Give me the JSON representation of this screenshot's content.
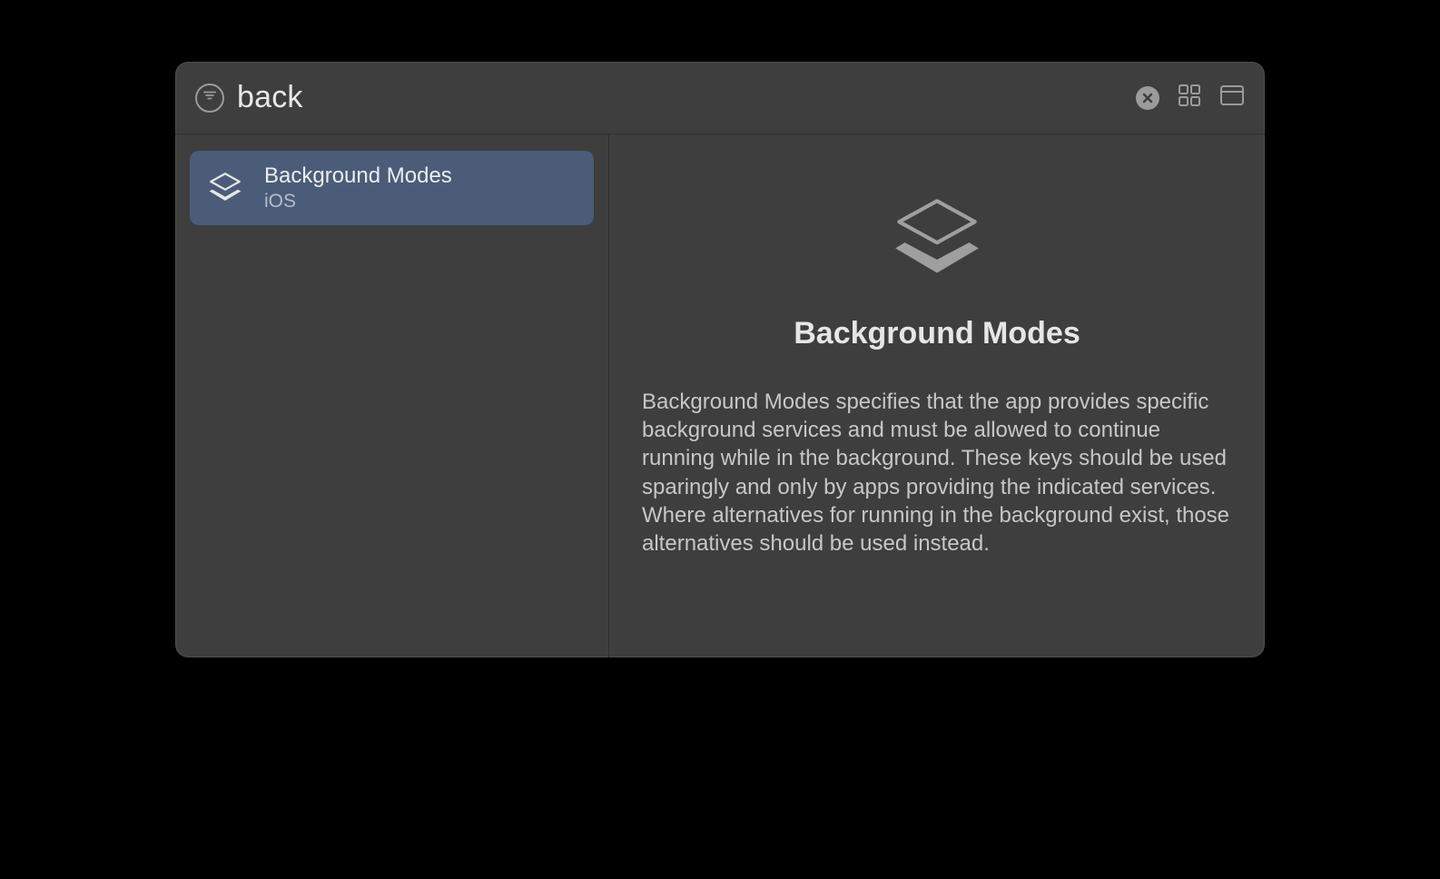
{
  "header": {
    "search_value": "back"
  },
  "sidebar": {
    "items": [
      {
        "title": "Background Modes",
        "subtitle": "iOS"
      }
    ]
  },
  "detail": {
    "title": "Background Modes",
    "description": "Background Modes specifies that the app provides specific background services and must be allowed to continue running while in the background. These keys should be used sparingly and only by apps providing the indicated services. Where alternatives for running in the background exist, those alternatives should be used instead."
  }
}
